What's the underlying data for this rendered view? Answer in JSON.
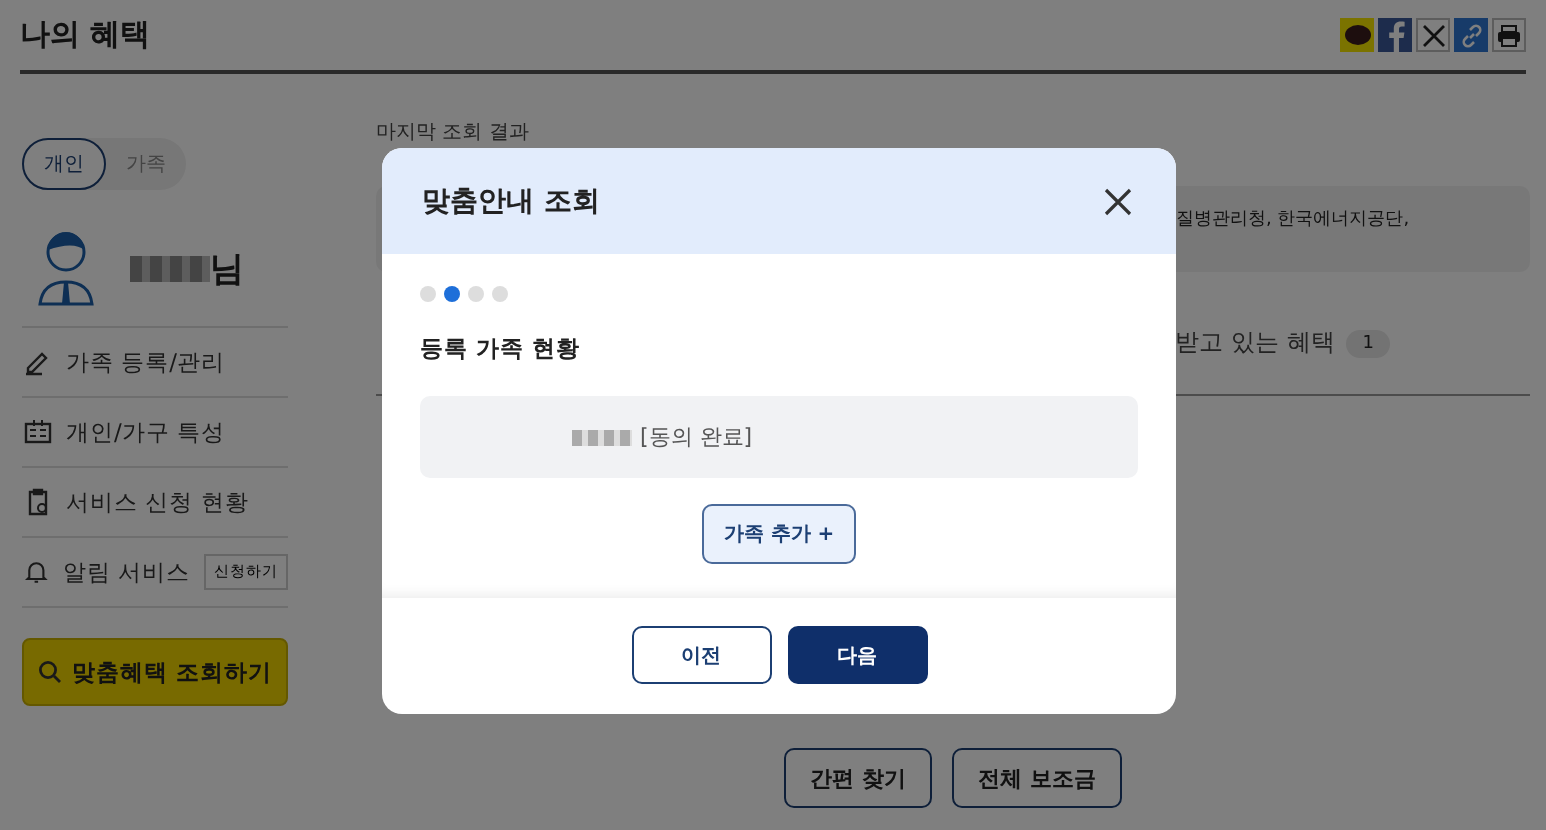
{
  "page": {
    "title": "나의 혜택"
  },
  "share_icons": [
    {
      "kind": "kakao"
    },
    {
      "kind": "facebook"
    },
    {
      "kind": "x"
    },
    {
      "kind": "link"
    },
    {
      "kind": "print"
    }
  ],
  "scope_tabs": [
    {
      "label": "개인",
      "selected": true
    },
    {
      "label": "가족",
      "selected": false
    }
  ],
  "profile": {
    "suffix": "님"
  },
  "menu": [
    {
      "kind": "edit",
      "label": "가족 등록/관리"
    },
    {
      "kind": "card",
      "label": "개인/가구 특성"
    },
    {
      "kind": "clipboard",
      "label": "서비스 신청 현황"
    },
    {
      "kind": "bell",
      "label": "알림 서비스",
      "action": "신청하기"
    }
  ],
  "search_button": "맞춤혜택 조회하기",
  "last_lookup": {
    "label": "마지막 조회 결과"
  },
  "agencies_text": "질병관리청, 한국에너지공단,",
  "benefit_tab": {
    "label": "받고 있는 혜택",
    "count": "1"
  },
  "bottom_buttons": [
    "간편 찾기",
    "전체 보조금"
  ],
  "modal": {
    "title": "맞춤안내 조회",
    "steps": [
      {
        "selected": false
      },
      {
        "selected": true
      },
      {
        "selected": false
      },
      {
        "selected": false
      }
    ],
    "section_title": "등록 가족 현황",
    "family": [
      {
        "status": "[동의 완료]"
      }
    ],
    "add_button": "가족 추가 +",
    "prev_button": "이전",
    "next_button": "다음"
  }
}
